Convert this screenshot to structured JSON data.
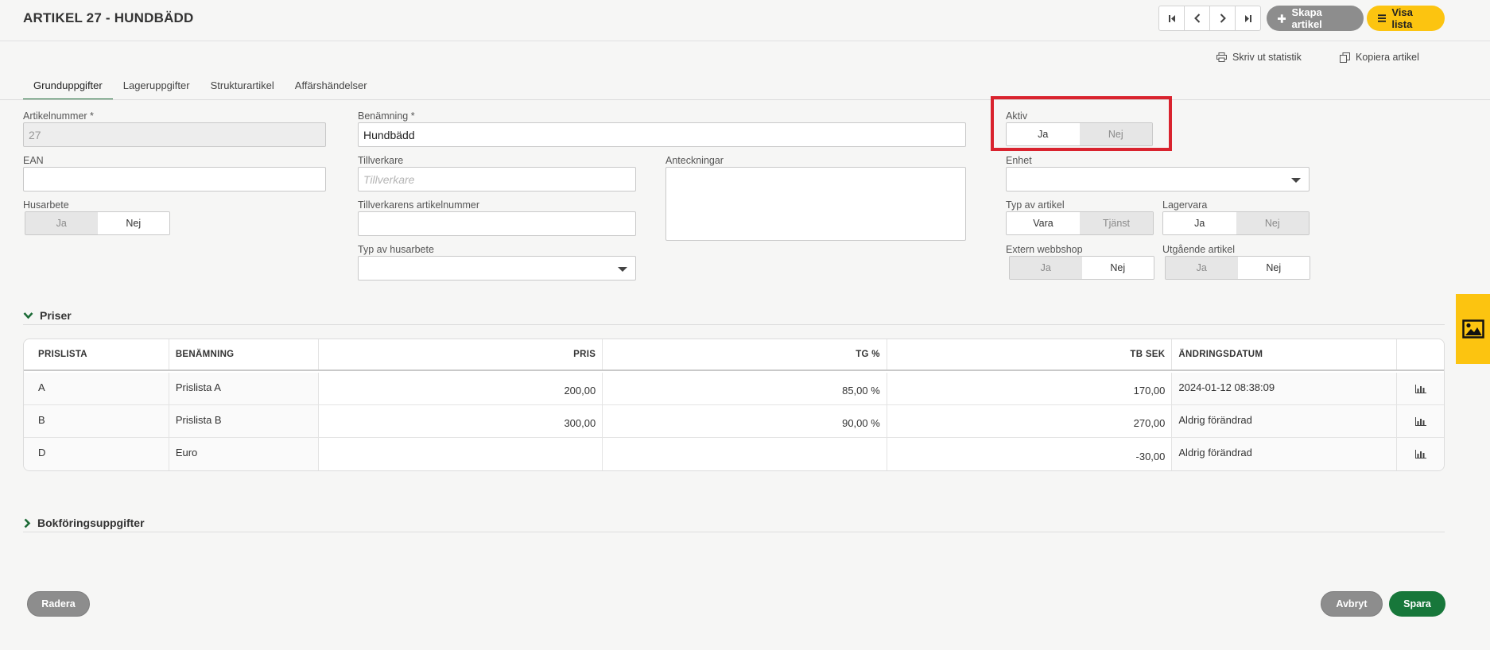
{
  "header": {
    "title": "ARTIKEL 27 - HUNDBÄDD",
    "create_label": "Skapa artikel",
    "list_label": "Visa lista",
    "nav_icons": [
      "first-page-icon",
      "prev-icon",
      "next-icon",
      "last-page-icon"
    ]
  },
  "actions": {
    "print_stats": "Skriv ut statistik",
    "copy_article": "Kopiera artikel"
  },
  "tabs": [
    "Grunduppgifter",
    "Lageruppgifter",
    "Strukturartikel",
    "Affärshändelser"
  ],
  "form": {
    "artikelnummer": {
      "label": "Artikelnummer *",
      "value": "27"
    },
    "benamning": {
      "label": "Benämning *",
      "value": "Hundbädd"
    },
    "aktiv": {
      "label": "Aktiv",
      "yes": "Ja",
      "no": "Nej",
      "selected": "Ja"
    },
    "ean": {
      "label": "EAN",
      "value": ""
    },
    "tillverkare": {
      "label": "Tillverkare",
      "placeholder": "Tillverkare"
    },
    "anteckningar": {
      "label": "Anteckningar",
      "value": ""
    },
    "enhet": {
      "label": "Enhet",
      "value": ""
    },
    "husarbete": {
      "label": "Husarbete",
      "yes": "Ja",
      "no": "Nej",
      "selected": "Nej"
    },
    "tillverkarens_artikelnummer": {
      "label": "Tillverkarens artikelnummer",
      "value": ""
    },
    "typ_av_artikel": {
      "label": "Typ av artikel",
      "opt1": "Vara",
      "opt2": "Tjänst",
      "selected": "Vara"
    },
    "lagervara": {
      "label": "Lagervara",
      "yes": "Ja",
      "no": "Nej",
      "selected": "Ja"
    },
    "typ_av_husarbete": {
      "label": "Typ av husarbete",
      "value": ""
    },
    "extern_webbshop": {
      "label": "Extern webbshop",
      "yes": "Ja",
      "no": "Nej",
      "selected": "Nej"
    },
    "utgaende_artikel": {
      "label": "Utgående artikel",
      "yes": "Ja",
      "no": "Nej",
      "selected": "Nej"
    }
  },
  "prices": {
    "section_title": "Priser",
    "columns": [
      "PRISLISTA",
      "BENÄMNING",
      "PRIS",
      "TG %",
      "TB SEK",
      "ÄNDRINGSDATUM"
    ],
    "rows": [
      {
        "prislista": "A",
        "benamning": "Prislista A",
        "pris": "200,00",
        "tg": "85,00 %",
        "tb": "170,00",
        "datum": "2024-01-12 08:38:09"
      },
      {
        "prislista": "B",
        "benamning": "Prislista B",
        "pris": "300,00",
        "tg": "90,00 %",
        "tb": "270,00",
        "datum": "Aldrig förändrad"
      },
      {
        "prislista": "D",
        "benamning": "Euro",
        "pris": "",
        "tg": "",
        "tb": "-30,00",
        "datum": "Aldrig förändrad"
      }
    ]
  },
  "bookkeeping": {
    "section_title": "Bokföringsuppgifter"
  },
  "buttons": {
    "delete": "Radera",
    "cancel": "Avbryt",
    "save": "Spara"
  },
  "colors": {
    "accent_green": "#17773a",
    "accent_yellow": "#fcc410",
    "highlight_red": "#d9232e"
  }
}
